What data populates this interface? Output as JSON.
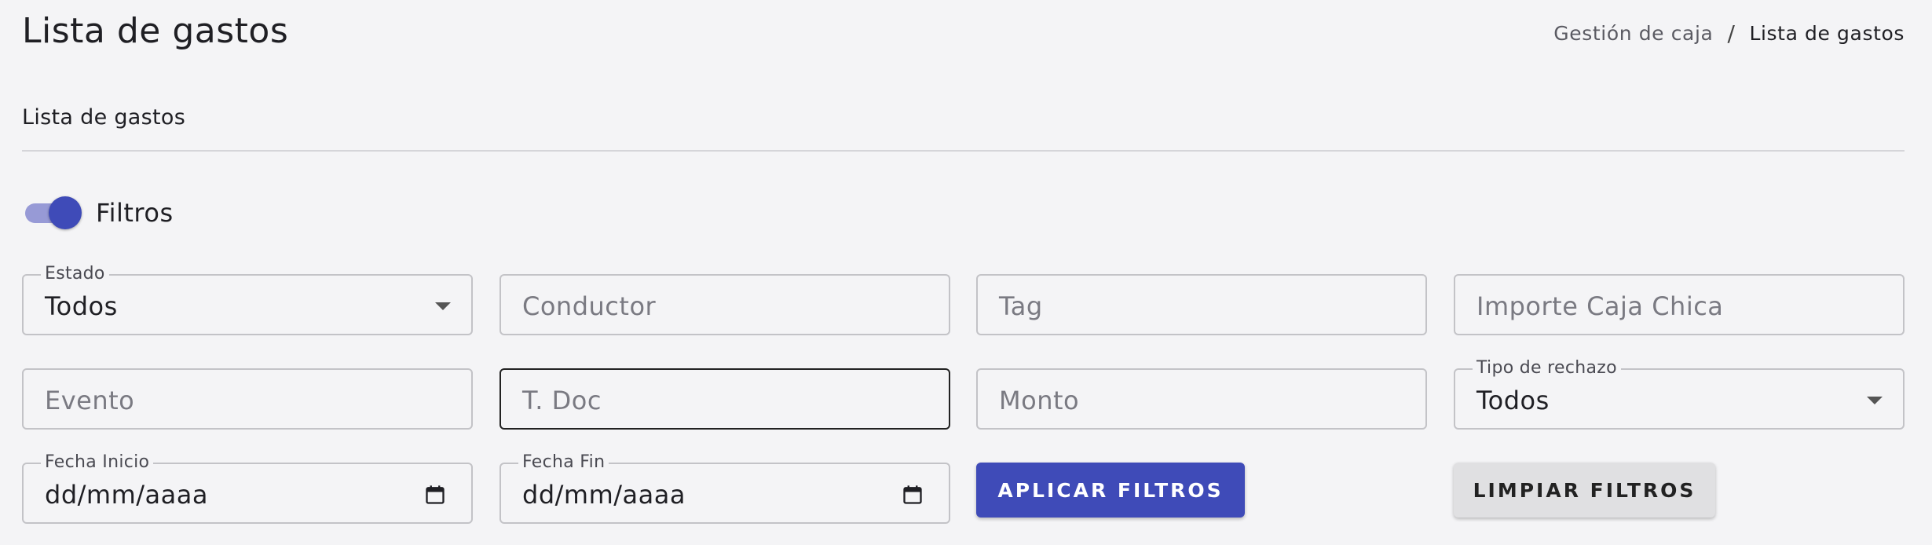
{
  "header": {
    "title": "Lista de gastos",
    "breadcrumb": {
      "parent": "Gestión de caja",
      "separator": "/",
      "current": "Lista de gastos"
    }
  },
  "section": {
    "title": "Lista de gastos"
  },
  "filters_toggle": {
    "label": "Filtros",
    "on": true
  },
  "filters": {
    "estado": {
      "label": "Estado",
      "value": "Todos"
    },
    "conductor": {
      "placeholder": "Conductor"
    },
    "tag": {
      "placeholder": "Tag"
    },
    "importe_caja_chica": {
      "placeholder": "Importe Caja Chica"
    },
    "evento": {
      "placeholder": "Evento"
    },
    "t_doc": {
      "placeholder": "T. Doc"
    },
    "monto": {
      "placeholder": "Monto"
    },
    "tipo_rechazo": {
      "label": "Tipo de rechazo",
      "value": "Todos"
    },
    "fecha_inicio": {
      "label": "Fecha Inicio",
      "value": "dd/mm/aaaa"
    },
    "fecha_fin": {
      "label": "Fecha Fin",
      "value": "dd/mm/aaaa"
    }
  },
  "actions": {
    "apply": "APLICAR FILTROS",
    "clear": "LIMPIAR FILTROS"
  },
  "colors": {
    "primary": "#3f4bb8",
    "toggle_track": "#979ad6",
    "background": "#f4f4f6"
  },
  "icons": {
    "select": "chevron-down-icon",
    "date": "calendar-icon"
  }
}
